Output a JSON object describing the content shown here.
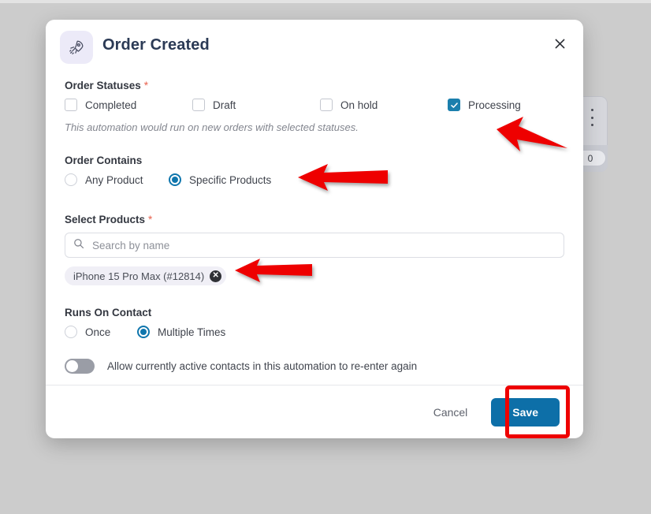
{
  "modal": {
    "icon": "rocket-icon",
    "title": "Order Created",
    "close_icon": "close-icon"
  },
  "order_statuses": {
    "label": "Order Statuses",
    "required_marker": "*",
    "options": [
      {
        "label": "Completed",
        "checked": false
      },
      {
        "label": "Draft",
        "checked": false
      },
      {
        "label": "On hold",
        "checked": false
      },
      {
        "label": "Processing",
        "checked": true
      }
    ],
    "hint": "This automation would run on new orders with selected statuses."
  },
  "order_contains": {
    "label": "Order Contains",
    "options": [
      {
        "label": "Any Product",
        "selected": false
      },
      {
        "label": "Specific Products",
        "selected": true
      }
    ]
  },
  "select_products": {
    "label": "Select Products",
    "required_marker": "*",
    "search_placeholder": "Search by name",
    "search_value": "",
    "search_icon": "search-icon",
    "chips": [
      {
        "label": "iPhone 15 Pro Max (#12814)",
        "remove_icon": "close-circle-icon"
      }
    ]
  },
  "runs_on_contact": {
    "label": "Runs On Contact",
    "options": [
      {
        "label": "Once",
        "selected": false
      },
      {
        "label": "Multiple Times",
        "selected": true
      }
    ],
    "toggle": {
      "label": "Allow currently active contacts in this automation to re-enter again",
      "on": false
    }
  },
  "footer": {
    "cancel_label": "Cancel",
    "save_label": "Save"
  },
  "background": {
    "card_badge_value": "0",
    "card_menu_icon": "kebab-menu-icon"
  },
  "colors": {
    "accent_blue": "#1b7fad",
    "save_blue": "#0d6fa8",
    "required_red": "#e8604c",
    "annotation_red": "#ee0000",
    "overlay_gray": "#cccccc",
    "icon_badge_bg": "#eceaf8"
  }
}
